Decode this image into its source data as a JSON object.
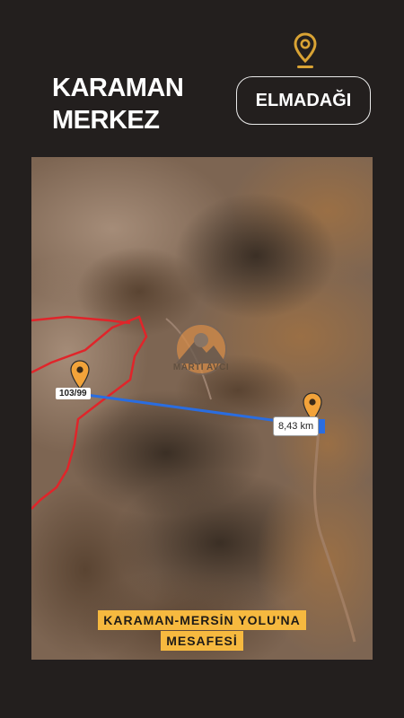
{
  "header": {
    "title_line1": "KARAMAN",
    "title_line2": "MERKEZ",
    "location_button": "ELMADAĞI",
    "pin_icon": "location-pin-icon"
  },
  "map": {
    "plot_label": "103/99",
    "distance_label": "8,43 km",
    "watermark_text": "MARTI AVCI",
    "caption_line1": "KARAMAN-MERSİN YOLU'NA",
    "caption_line2": "MESAFESİ"
  },
  "colors": {
    "background": "#231f1e",
    "pin_gold": "#d9a334",
    "marker_orange": "#f2a33a",
    "route_blue": "#2a6de0",
    "boundary_red": "#e0252a",
    "caption_bg": "#f6b93f"
  }
}
